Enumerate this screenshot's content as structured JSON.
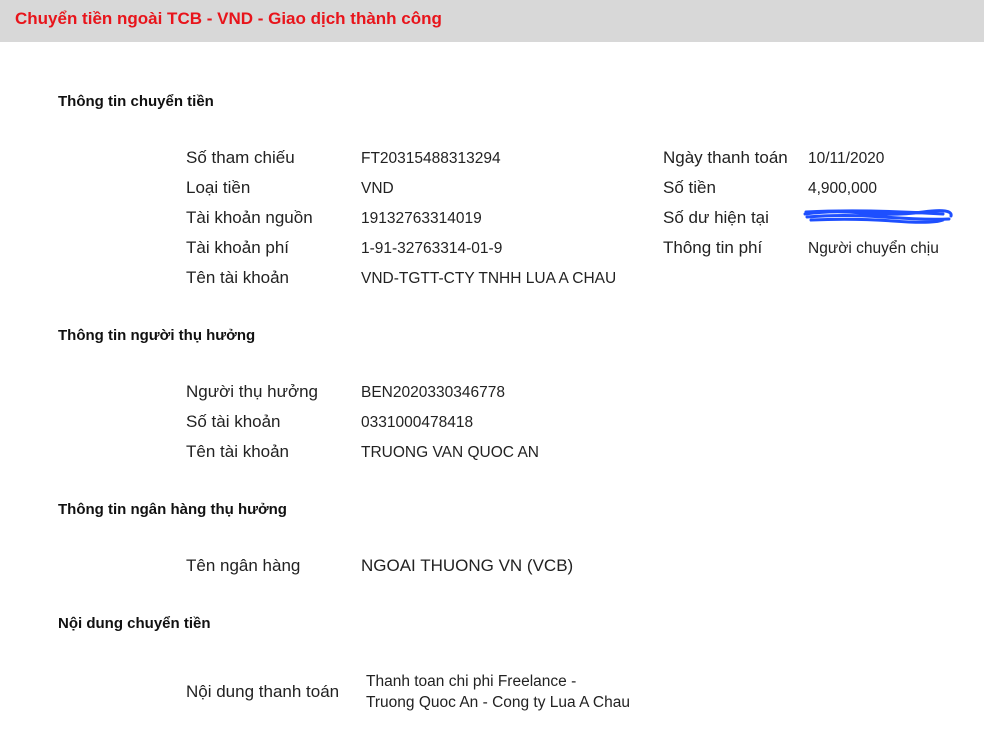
{
  "header": {
    "title": "Chuyển tiền ngoài TCB - VND - Giao dịch thành công"
  },
  "transfer_info": {
    "title": "Thông tin chuyển tiền",
    "reference_label": "Số tham chiếu",
    "reference_value": "FT20315488313294",
    "currency_label": "Loại tiền",
    "currency_value": "VND",
    "source_account_label": "Tài khoản nguồn",
    "source_account_value": "19132763314019",
    "fee_account_label": "Tài khoản phí",
    "fee_account_value": "1-91-32763314-01-9",
    "account_name_label": "Tên tài khoản",
    "account_name_value": "VND-TGTT-CTY TNHH LUA A CHAU",
    "payment_date_label": "Ngày thanh toán",
    "payment_date_value": "10/11/2020",
    "amount_label": "Số tiền",
    "amount_value": "4,900,000",
    "balance_label": "Số dư hiện tại",
    "fee_info_label": "Thông tin phí",
    "fee_info_value": "Người chuyển chịu"
  },
  "beneficiary_info": {
    "title": "Thông tin người thụ hưởng",
    "beneficiary_label": "Người thụ hưởng",
    "beneficiary_value": "BEN2020330346778",
    "account_number_label": "Số tài khoản",
    "account_number_value": "0331000478418",
    "account_name_label": "Tên tài khoản",
    "account_name_value": "TRUONG VAN QUOC AN"
  },
  "beneficiary_bank": {
    "title": "Thông tin ngân hàng thụ hưởng",
    "bank_name_label": "Tên ngân hàng",
    "bank_name_value": "NGOAI THUONG VN (VCB)"
  },
  "transfer_content": {
    "title": "Nội dung chuyển tiền",
    "content_label": "Nội dung thanh toán",
    "content_line1": "Thanh toan chi phi Freelance -",
    "content_line2": "Truong Quoc An - Cong ty Lua A Chau"
  },
  "colors": {
    "header_bg": "#d8d8d8",
    "header_text": "#e8141b",
    "redaction": "#1e4fff"
  }
}
